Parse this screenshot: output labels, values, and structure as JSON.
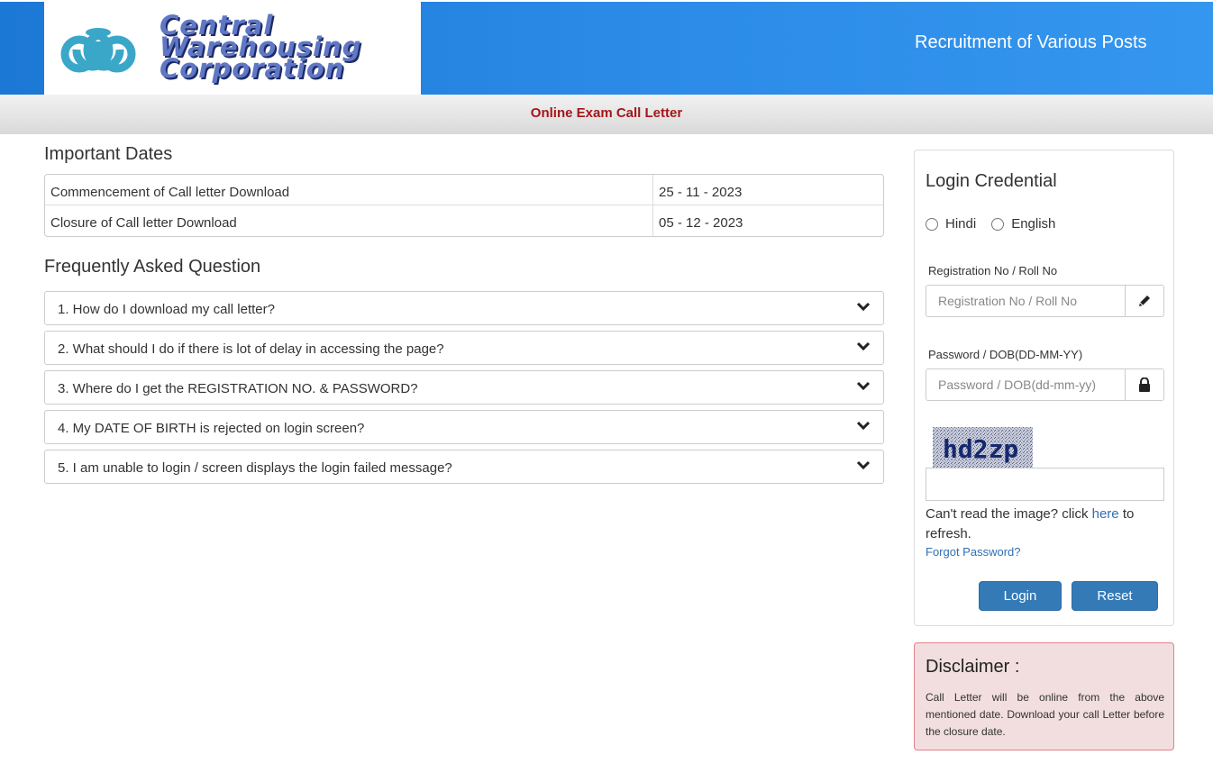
{
  "header": {
    "org_line1": "Central",
    "org_line2": "Warehousing",
    "org_line3": "Corporation",
    "title": "Recruitment of Various Posts"
  },
  "subbar": {
    "title": "Online Exam Call Letter"
  },
  "dates": {
    "heading": "Important Dates",
    "rows": [
      {
        "label": "Commencement of Call letter Download",
        "value": "25 - 11 - 2023"
      },
      {
        "label": "Closure of Call letter Download",
        "value": "05 - 12 - 2023"
      }
    ]
  },
  "faq": {
    "heading": "Frequently Asked Question",
    "items": [
      "1. How do I download my call letter?",
      "2. What should I do if there is lot of delay in accessing the page?",
      "3. Where do I get the REGISTRATION NO. & PASSWORD?",
      "4. My DATE OF BIRTH is rejected on login screen?",
      "5. I am unable to login / screen displays the login failed message?"
    ]
  },
  "login": {
    "title": "Login Credential",
    "lang_hindi": "Hindi",
    "lang_english": "English",
    "reg_label": "Registration No / Roll No",
    "reg_placeholder": "Registration No / Roll No",
    "pwd_label": "Password / DOB(DD-MM-YY)",
    "pwd_placeholder": "Password / DOB(dd-mm-yy)",
    "captcha_text": "hd2zp",
    "refresh_prefix": "Can't read the image? click ",
    "refresh_link": "here",
    "refresh_suffix": " to refresh.",
    "forgot": "Forgot Password?",
    "login_btn": "Login",
    "reset_btn": "Reset"
  },
  "disclaimer": {
    "title": "Disclaimer :",
    "text": "Call Letter will be online from the above mentioned date. Download your call Letter before the closure date."
  },
  "colors": {
    "header_blue": "#2a8ae6",
    "subbar_title_red": "#a4161a",
    "button_blue": "#337ab7",
    "disclaimer_bg": "#f2dede"
  }
}
